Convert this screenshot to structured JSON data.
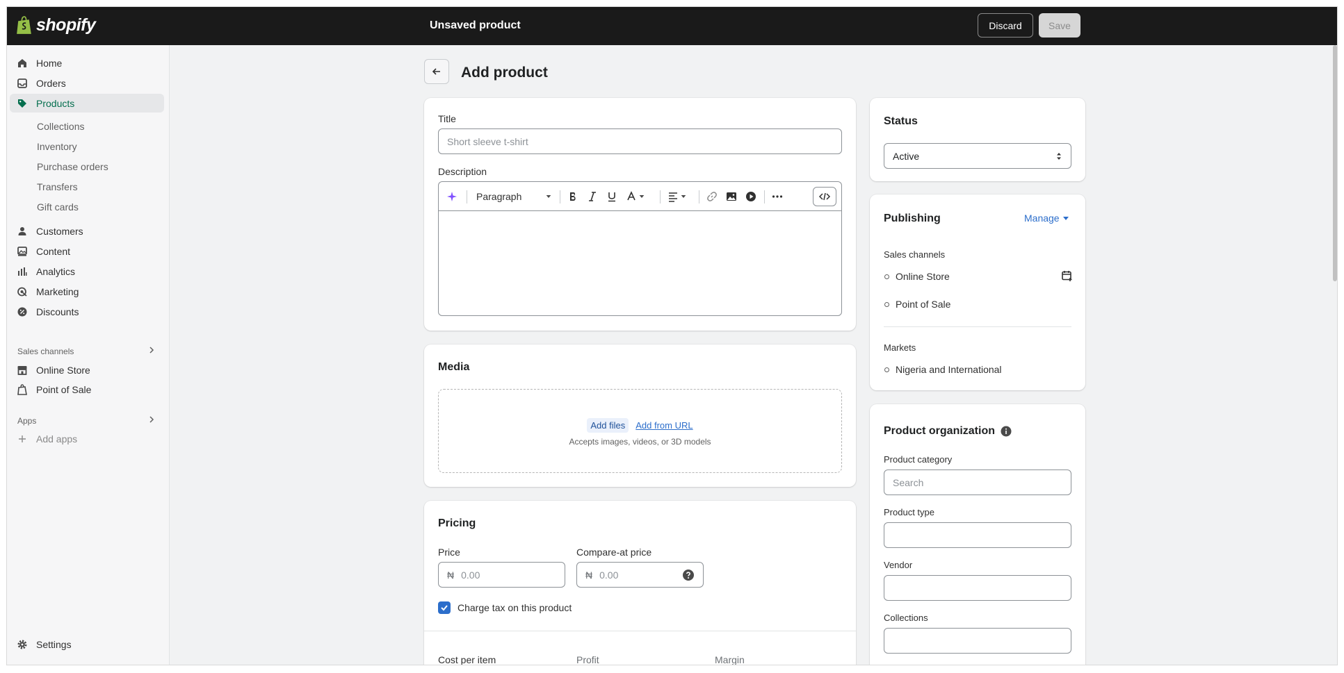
{
  "topbar": {
    "brand": "shopify",
    "title": "Unsaved product",
    "discard_label": "Discard",
    "save_label": "Save"
  },
  "sidebar": {
    "items": [
      {
        "label": "Home",
        "icon": "home-icon"
      },
      {
        "label": "Orders",
        "icon": "inbox-icon"
      },
      {
        "label": "Products",
        "icon": "tag-icon",
        "active": true
      },
      {
        "label": "Customers",
        "icon": "person-icon"
      },
      {
        "label": "Content",
        "icon": "image-icon"
      },
      {
        "label": "Analytics",
        "icon": "bar-chart-icon"
      },
      {
        "label": "Marketing",
        "icon": "target-icon"
      },
      {
        "label": "Discounts",
        "icon": "discount-icon"
      }
    ],
    "product_subitems": [
      "Collections",
      "Inventory",
      "Purchase orders",
      "Transfers",
      "Gift cards"
    ],
    "sales_channels_label": "Sales channels",
    "sales_channels": [
      {
        "label": "Online Store",
        "icon": "store-icon"
      },
      {
        "label": "Point of Sale",
        "icon": "shopify-bag-icon"
      }
    ],
    "apps_label": "Apps",
    "add_apps_label": "Add apps",
    "settings_label": "Settings"
  },
  "page": {
    "title": "Add product"
  },
  "product_card": {
    "title_label": "Title",
    "title_placeholder": "Short sleeve t-shirt",
    "description_label": "Description",
    "format_select": "Paragraph"
  },
  "media": {
    "heading": "Media",
    "add_files": "Add files",
    "add_from_url": "Add from URL",
    "hint": "Accepts images, videos, or 3D models"
  },
  "pricing": {
    "heading": "Pricing",
    "price_label": "Price",
    "compare_label": "Compare-at price",
    "currency_symbol": "₦",
    "price_placeholder": "0.00",
    "compare_placeholder": "0.00",
    "charge_tax_label": "Charge tax on this product",
    "charge_tax_checked": true,
    "cost_label": "Cost per item",
    "profit_label": "Profit",
    "margin_label": "Margin"
  },
  "status": {
    "heading": "Status",
    "value": "Active"
  },
  "publishing": {
    "heading": "Publishing",
    "manage_label": "Manage",
    "sales_channels_label": "Sales channels",
    "channels": [
      "Online Store",
      "Point of Sale"
    ],
    "markets_label": "Markets",
    "markets": [
      "Nigeria and International"
    ]
  },
  "organization": {
    "heading": "Product organization",
    "category_label": "Product category",
    "category_placeholder": "Search",
    "type_label": "Product type",
    "vendor_label": "Vendor",
    "collections_label": "Collections"
  },
  "colors": {
    "topbar": "#1a1a1a",
    "active_nav": "#046e4e",
    "link": "#2c6ecb",
    "background": "#f1f2f3"
  }
}
